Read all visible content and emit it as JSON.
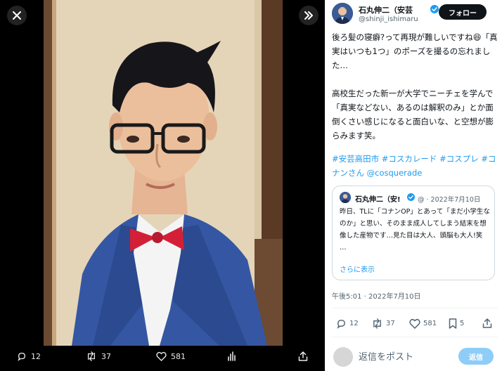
{
  "viewer": {
    "close_icon": "close-icon",
    "expand_icon": "double-chevron-right-icon",
    "actions": {
      "reply_count": "12",
      "retweet_count": "37",
      "like_count": "581"
    }
  },
  "author": {
    "name": "石丸伸二（安芸",
    "handle": "@shinji_ishimaru",
    "follow_label": "フォロー"
  },
  "tweet": {
    "text": "後ろ髪の寝癖?って再現が難しいですね😆「真実はいつも1つ」のポーズを撮るの忘れました…\n\n高校生だった新一が大学でニーチェを学んで「真実などない、あるのは解釈のみ」とか面倒くさい感じになると面白いな、と空想が膨らみます笑。",
    "hashtags": "#安芸高田市 #コスカレード #コスプレ #コナンさん @cosquerade",
    "timestamp": "午後5:01 · 2022年7月10日",
    "actions": {
      "reply_count": "12",
      "retweet_count": "37",
      "like_count": "581",
      "bookmark_count": "5"
    }
  },
  "quote": {
    "name": "石丸伸二（安!",
    "meta": "@ · 2022年7月10日",
    "text": "昨日、TLに「コナンOP」とあって「まだ小学生なのか」と思い、そのまま成人してしまう結末を想像した産物です…見た目は大人、頭脳も大人!笑\n…",
    "show_more": "さらに表示"
  },
  "reply": {
    "placeholder": "返信をポスト",
    "button_label": "返信"
  },
  "colors": {
    "accent": "#1d9bf0",
    "verified": "#1d9bf0",
    "follow_bg": "#0f1419",
    "reply_btn_bg": "#8ecdf8"
  }
}
